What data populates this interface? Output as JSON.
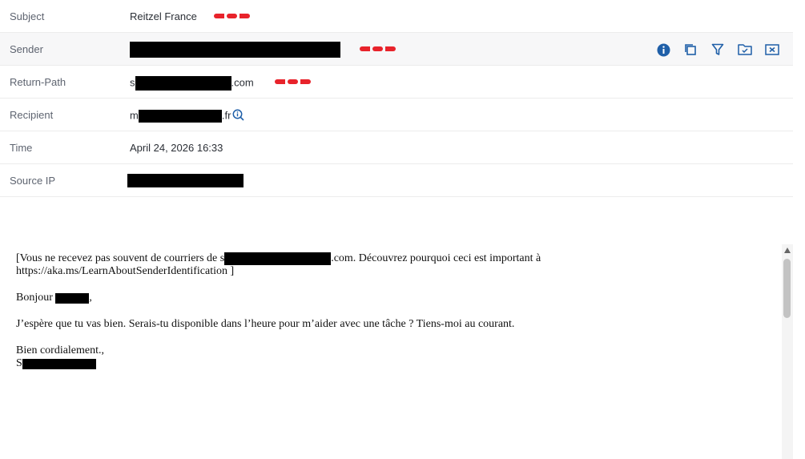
{
  "header": {
    "subject": {
      "label": "Subject",
      "value": "Reitzel France"
    },
    "sender": {
      "label": "Sender"
    },
    "return_path": {
      "label": "Return-Path",
      "prefix": "s",
      "suffix": ".com"
    },
    "recipient": {
      "label": "Recipient",
      "prefix": "m",
      "suffix": ".fr"
    },
    "time": {
      "label": "Time",
      "value": "April 24, 2026 16:33"
    },
    "source_ip": {
      "label": "Source IP"
    }
  },
  "actions": [
    {
      "name": "info-icon"
    },
    {
      "name": "copy-icon"
    },
    {
      "name": "filter-icon"
    },
    {
      "name": "move-to-folder-icon"
    },
    {
      "name": "delete-message-icon"
    }
  ],
  "colors": {
    "accent": "#1f5fa8",
    "risk": "#e8232b"
  },
  "message": {
    "line1_a": "[Vous ne recevez pas souvent de courriers de s",
    "line1_b": ".com. Découvrez pourquoi ceci est important à",
    "line1_c": "https://aka.ms/LearnAboutSenderIdentification ]",
    "greeting": "Bonjour",
    "greeting_end": ",",
    "body": "J’espère que tu vas bien. Serais-tu disponible dans l’heure pour m’aider avec une tâche ? Tiens-moi au courant.",
    "closing": "Bien cordialement.,",
    "signature_prefix": "S"
  }
}
